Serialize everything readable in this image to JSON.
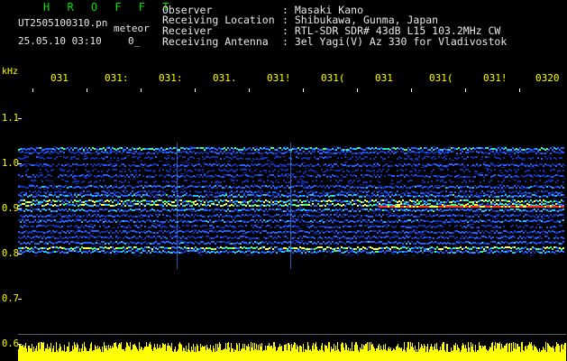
{
  "brand": "H R O F F T",
  "file_name": "UT2505100310.pn",
  "tag": "meteor",
  "datetime": "25.05.10 03:10",
  "zero_label": "0_",
  "info": {
    "observer_label": "Observer",
    "observer_value": ": Masaki Kano",
    "location_label": "Receiving Location",
    "location_value": ": Shibukawa, Gunma, Japan",
    "receiver_label": "Receiver",
    "receiver_value": ": RTL-SDR SDR# 43dB L15 103.2MHz CW",
    "antenna_label": "Receiving Antenna",
    "antenna_value": ": 3el Yagi(V) Az 330 for Vladivostok"
  },
  "axis": {
    "y_unit": "kHz",
    "x_ticks": [
      "031",
      "031:",
      "031:",
      "031.",
      "031!",
      "031(",
      "031",
      "031(",
      "031!",
      "0320"
    ],
    "y_ticks": [
      "1.1",
      "1.0",
      "0.9",
      "0.8",
      "0.7",
      "0.6"
    ]
  },
  "colors": {
    "background": "#000000",
    "header_green": "#00e000",
    "label_yellow": "#ffff00",
    "signal_red": "#ff2020",
    "noise_blue": "#1030c0"
  }
}
